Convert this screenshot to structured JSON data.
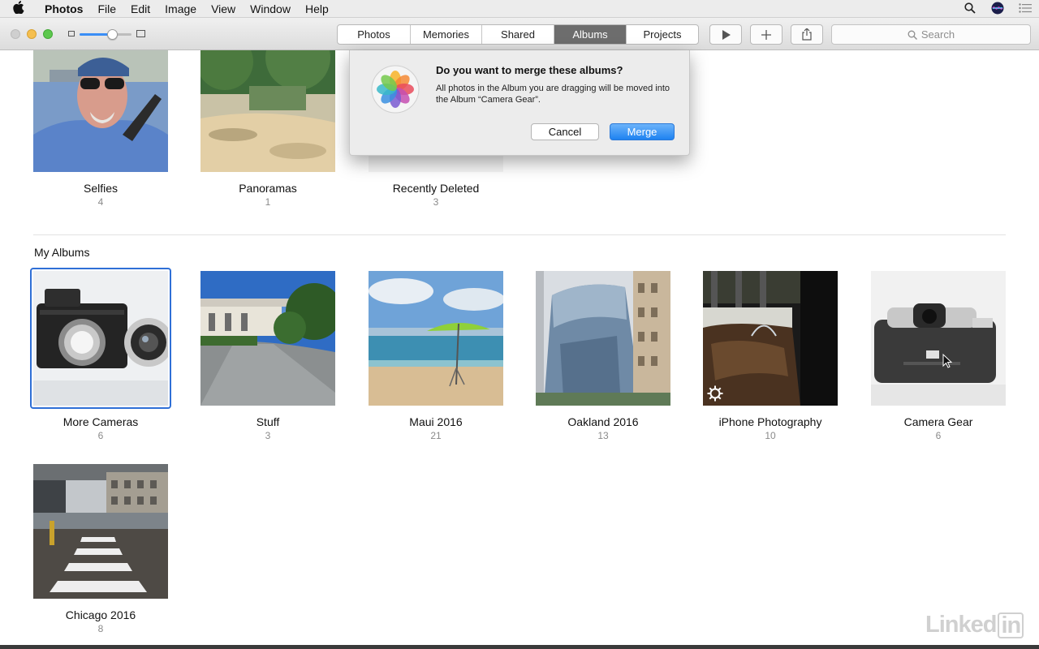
{
  "menubar": {
    "app": "Photos",
    "items": [
      "File",
      "Edit",
      "Image",
      "View",
      "Window",
      "Help"
    ],
    "icons": [
      "apple-icon",
      "search-icon",
      "siri-icon",
      "notification-list-icon"
    ]
  },
  "toolbar": {
    "tabs": [
      {
        "label": "Photos",
        "active": false
      },
      {
        "label": "Memories",
        "active": false
      },
      {
        "label": "Shared",
        "active": false
      },
      {
        "label": "Albums",
        "active": true
      },
      {
        "label": "Projects",
        "active": false
      }
    ],
    "buttons": [
      "play-icon",
      "plus-icon",
      "share-icon"
    ],
    "search_placeholder": "Search",
    "zoom_level": 0.67
  },
  "top_albums": [
    {
      "name": "Selfies",
      "count": "4"
    },
    {
      "name": "Panoramas",
      "count": "1"
    },
    {
      "name": "Recently Deleted",
      "count": "3"
    }
  ],
  "my_albums": {
    "title": "My Albums",
    "items": [
      {
        "name": "More Cameras",
        "count": "6",
        "selected": true
      },
      {
        "name": "Stuff",
        "count": "3"
      },
      {
        "name": "Maui 2016",
        "count": "21"
      },
      {
        "name": "Oakland 2016",
        "count": "13"
      },
      {
        "name": "iPhone Photography",
        "count": "10"
      },
      {
        "name": "Camera Gear",
        "count": "6"
      },
      {
        "name": "Chicago 2016",
        "count": "8"
      }
    ]
  },
  "dialog": {
    "title": "Do you want to merge these albums?",
    "message": "All photos in the Album you are dragging will be moved into the Album “Camera Gear”.",
    "cancel": "Cancel",
    "confirm": "Merge"
  },
  "watermark": {
    "text": "Linked",
    "suffix": "in"
  },
  "colors": {
    "accent": "#2f6fd6",
    "merge_button": "#1e82f1",
    "active_tab": "#6d6d6d"
  }
}
